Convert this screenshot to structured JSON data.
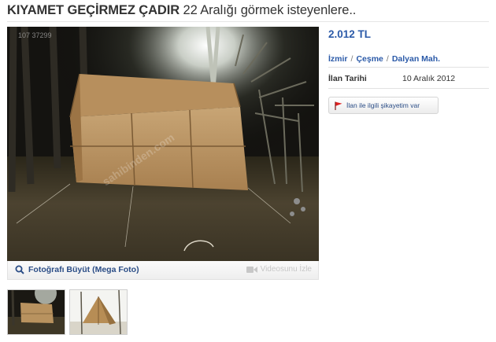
{
  "listing": {
    "title_bold": "KIYAMET GEÇİRMEZ ÇADIR",
    "title_rest": " 22 Aralığı görmek isteyenlere..",
    "price": "2.012 TL",
    "location": {
      "city": "İzmir",
      "district": "Çeşme",
      "neighborhood": "Dalyan Mah.",
      "separator": "/"
    },
    "date_label": "İlan Tarihi",
    "date_value": "10 Aralık 2012",
    "complaint_label": "İlan ile ilgili şikayetim var"
  },
  "photo": {
    "id_text": "107 37299",
    "watermark": "sahibinden.com",
    "enlarge_label": "Fotoğrafı Büyüt (Mega Foto)",
    "video_label": "Videosunu İzle",
    "thumbnail_count": 2
  },
  "icons": {
    "enlarge": "magnifier-icon",
    "video": "video-camera-icon",
    "complaint": "red-flag-icon"
  },
  "colors": {
    "link": "#2b5aa8",
    "flag": "#e02020",
    "disabled": "#c7c7c7"
  }
}
